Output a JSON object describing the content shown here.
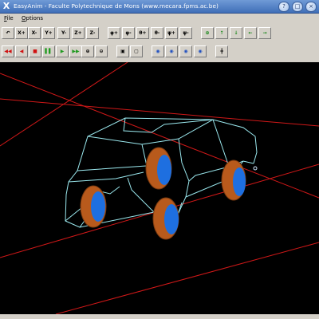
{
  "window": {
    "title": "EasyAnim - Faculte Polytechnique de Mons (www.mecara.fpms.ac.be)",
    "app_icon": "X",
    "controls": [
      "?",
      "□",
      "×"
    ]
  },
  "menu": [
    {
      "label": "File",
      "accel": "F"
    },
    {
      "label": "Options",
      "accel": "O"
    }
  ],
  "toolbar1": [
    {
      "name": "undo-view-button",
      "label": "↶",
      "icon": "undo-icon"
    },
    {
      "name": "rotate-x-plus-button",
      "label": "X+",
      "icon": "axis-x-plus-icon"
    },
    {
      "name": "rotate-x-minus-button",
      "label": "X-",
      "icon": "axis-x-minus-icon"
    },
    {
      "name": "rotate-y-plus-button",
      "label": "Y+",
      "icon": "axis-y-plus-icon"
    },
    {
      "name": "rotate-y-minus-button",
      "label": "Y-",
      "icon": "axis-y-minus-icon"
    },
    {
      "name": "rotate-z-plus-button",
      "label": "Z+",
      "icon": "axis-z-plus-icon"
    },
    {
      "name": "rotate-z-minus-button",
      "label": "Z-",
      "icon": "axis-z-minus-icon"
    },
    {
      "name": "phi-plus-button",
      "label": "φ+",
      "icon": "phi-plus-icon"
    },
    {
      "name": "phi-minus-button",
      "label": "φ-",
      "icon": "phi-minus-icon"
    },
    {
      "name": "theta-plus-button",
      "label": "θ+",
      "icon": "theta-plus-icon"
    },
    {
      "name": "theta-minus-button",
      "label": "θ-",
      "icon": "theta-minus-icon"
    },
    {
      "name": "psi-plus-button",
      "label": "ψ+",
      "icon": "psi-plus-icon"
    },
    {
      "name": "psi-minus-button",
      "label": "ψ-",
      "icon": "psi-minus-icon"
    },
    {
      "name": "pan-center-button",
      "label": "⊕",
      "icon": "crosshair-icon"
    },
    {
      "name": "pan-up-button",
      "label": "↑",
      "icon": "arrow-up-icon"
    },
    {
      "name": "pan-down-button",
      "label": "↓",
      "icon": "arrow-down-icon"
    },
    {
      "name": "pan-left-button",
      "label": "←",
      "icon": "arrow-left-icon"
    },
    {
      "name": "pan-right-button",
      "label": "→",
      "icon": "arrow-right-icon"
    }
  ],
  "toolbar2": [
    {
      "name": "rewind-button",
      "label": "◀◀",
      "icon": "rewind-icon"
    },
    {
      "name": "step-back-button",
      "label": "◀",
      "icon": "step-back-icon"
    },
    {
      "name": "stop-button",
      "label": "■",
      "icon": "stop-icon"
    },
    {
      "name": "pause-button",
      "label": "▌▌",
      "icon": "pause-icon"
    },
    {
      "name": "play-button",
      "label": "▶",
      "icon": "play-icon"
    },
    {
      "name": "fast-forward-button",
      "label": "▶▶",
      "icon": "fast-forward-icon"
    },
    {
      "name": "zoom-in-button",
      "label": "⊕",
      "icon": "zoom-in-icon"
    },
    {
      "name": "zoom-out-button",
      "label": "⊖",
      "icon": "zoom-out-icon"
    },
    {
      "name": "view-solid-button",
      "label": "▣",
      "icon": "solid-view-icon"
    },
    {
      "name": "view-wire-button",
      "label": "▢",
      "icon": "wire-view-icon"
    },
    {
      "name": "camera-1-button",
      "label": "◉",
      "icon": "camera-icon"
    },
    {
      "name": "camera-2-button",
      "label": "◉",
      "icon": "camera-icon"
    },
    {
      "name": "camera-3-button",
      "label": "◉",
      "icon": "camera-icon"
    },
    {
      "name": "camera-4-button",
      "label": "◉",
      "icon": "camera-icon"
    },
    {
      "name": "axes-toggle-button",
      "label": "╋",
      "icon": "axes-icon"
    }
  ],
  "colors": {
    "background": "#000000",
    "wireframe": "#9be9ef",
    "ground_lines": "#d01818",
    "tire": "#b85a1c",
    "rim": "#1e6fe0"
  }
}
